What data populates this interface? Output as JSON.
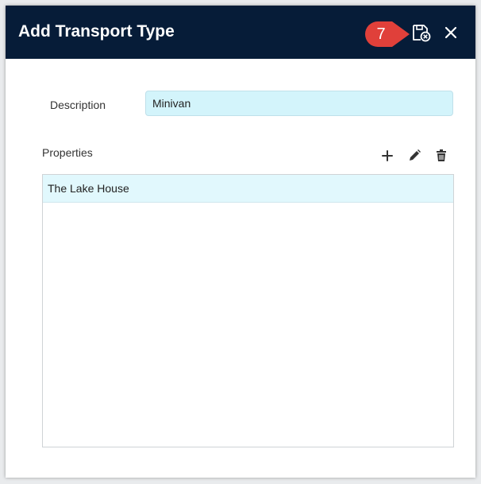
{
  "dialog": {
    "title": "Add Transport Type",
    "step_marker": "7",
    "header_color": "#061c38",
    "callout_color": "#e0403a"
  },
  "header_actions": {
    "save_close_icon": "save-close-icon",
    "close_icon": "close-icon"
  },
  "form": {
    "description_label": "Description",
    "description_value": "Minivan",
    "properties_label": "Properties"
  },
  "properties_toolbar": {
    "add_icon": "plus-icon",
    "edit_icon": "pencil-icon",
    "delete_icon": "trash-icon"
  },
  "properties": {
    "items": [
      {
        "label": "The Lake House"
      }
    ]
  }
}
